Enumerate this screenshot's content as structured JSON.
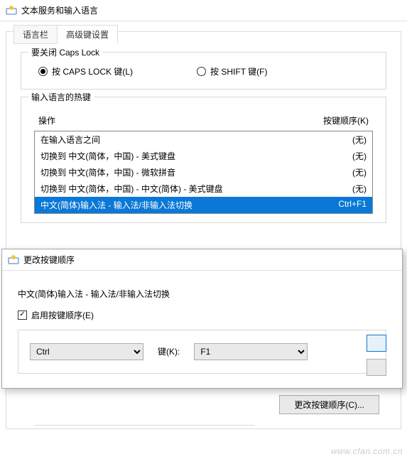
{
  "window": {
    "title": "文本服务和输入语言"
  },
  "tabs": {
    "items": [
      "语言栏",
      "高级键设置"
    ],
    "activeIndex": 1
  },
  "groupCaps": {
    "title": "要关闭 Caps Lock",
    "opt1": "按 CAPS LOCK 键(L)",
    "opt2": "按 SHIFT 键(F)"
  },
  "groupHotkey": {
    "title": "输入语言的热键",
    "hdrAction": "操作",
    "hdrKey": "按键顺序(K)",
    "rows": [
      {
        "action": "在输入语言之间",
        "key": "(无)"
      },
      {
        "action": "切换到 中文(简体，中国) - 美式键盘",
        "key": "(无)"
      },
      {
        "action": "切换到 中文(简体，中国) - 微软拼音",
        "key": "(无)"
      },
      {
        "action": "切换到 中文(简体，中国) - 中文(简体) - 美式键盘",
        "key": "(无)"
      },
      {
        "action": "中文(简体)输入法 - 输入法/非输入法切换",
        "key": "Ctrl+F1"
      }
    ],
    "selectedIndex": 4
  },
  "modal": {
    "title": "更改按键顺序",
    "subtitle": "中文(简体)输入法 - 输入法/非输入法切换",
    "enableLabel": "启用按键顺序(E)",
    "enabled": true,
    "modifier": "Ctrl",
    "keyLabel": "键(K):",
    "key": "F1"
  },
  "bottom": {
    "changeBtn": "更改按键顺序(C)..."
  },
  "watermark": "www.cfan.com.cn"
}
